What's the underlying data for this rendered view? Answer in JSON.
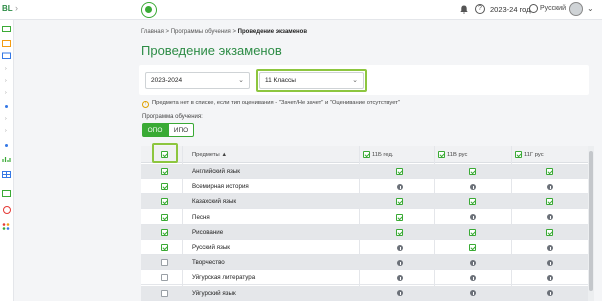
{
  "topbar": {
    "brand_text": "BL",
    "year": "2023-24 год",
    "language": "Русский"
  },
  "breadcrumb": {
    "items": [
      "Главная",
      "Программы обучения"
    ],
    "separator": ">",
    "current": "Проведение экзаменов"
  },
  "page": {
    "title": "Проведение экзаменов"
  },
  "filters": {
    "year_value": "2023-2024",
    "class_value": "11 Классы"
  },
  "note": "Предмета нет в списке, если тип оценивания - \"Зачет/Не зачет\" и \"Оценивание отсутствует\"",
  "program": {
    "label": "Программа обучения:",
    "options": [
      "ОПО",
      "ИПО"
    ],
    "selected": "ОПО"
  },
  "table": {
    "headers": {
      "subjects": "Предметы",
      "sort_arrow": "▲",
      "classes": [
        "11Б гед.",
        "11В рус",
        "11Г рус"
      ]
    },
    "rows": [
      {
        "subject": "Английский язык",
        "selected": true,
        "cells": [
          "check",
          "check",
          "check"
        ]
      },
      {
        "subject": "Всемирная история",
        "selected": true,
        "cells": [
          "info",
          "info",
          "info"
        ]
      },
      {
        "subject": "Казахский язык",
        "selected": true,
        "cells": [
          "check",
          "check",
          "check"
        ]
      },
      {
        "subject": "Песня",
        "selected": true,
        "cells": [
          "check",
          "info",
          "info"
        ]
      },
      {
        "subject": "Рисование",
        "selected": true,
        "cells": [
          "check",
          "check",
          "check"
        ]
      },
      {
        "subject": "Русский язык",
        "selected": true,
        "cells": [
          "info",
          "check",
          "info"
        ]
      },
      {
        "subject": "Творчество",
        "selected": false,
        "cells": [
          "info",
          "info",
          "info"
        ]
      },
      {
        "subject": "Уйгурская литература",
        "selected": false,
        "cells": [
          "info",
          "info",
          "info"
        ]
      },
      {
        "subject": "Уйгурский язык",
        "selected": false,
        "cells": [
          "info",
          "info",
          "info"
        ]
      }
    ]
  },
  "colors": {
    "accent": "#3aaa35",
    "title": "#2d8c46",
    "highlight": "#8dc63f",
    "info": "#6b7078"
  },
  "icons": [
    "bell-icon",
    "help-icon",
    "globe-icon",
    "avatar",
    "warning-icon",
    "check-icon",
    "info-icon",
    "chevron-down-icon"
  ]
}
